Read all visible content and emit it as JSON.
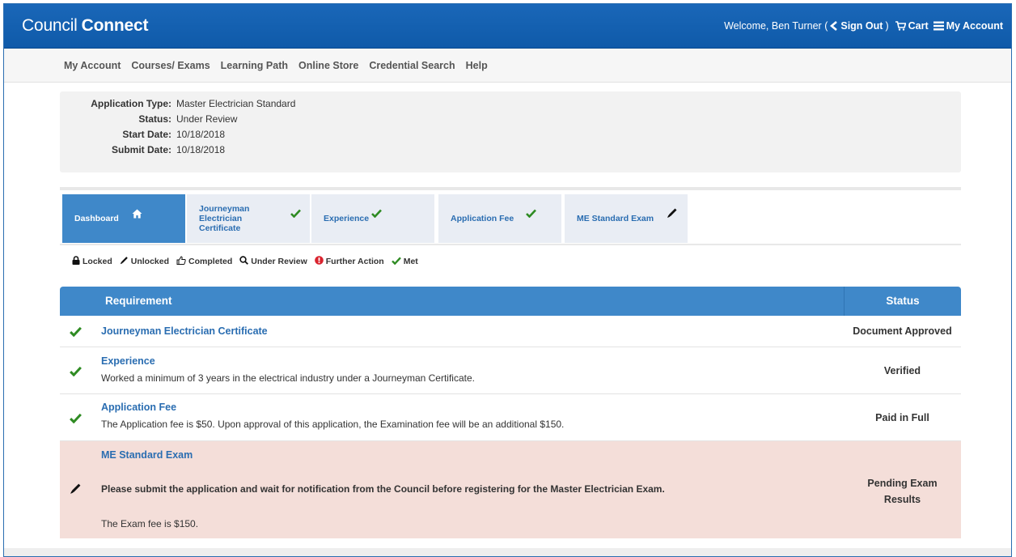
{
  "header": {
    "brand_light": "Council",
    "brand_bold": "Connect",
    "welcome": "Welcome, Ben Turner (",
    "sign_out": "Sign Out",
    "close_paren": ")",
    "cart": "Cart",
    "my_account": "My Account"
  },
  "nav": {
    "items": [
      "My Account",
      "Courses/ Exams",
      "Learning Path",
      "Online Store",
      "Credential Search",
      "Help"
    ]
  },
  "application": {
    "type_label": "Application Type:",
    "type_value": "Master Electrician Standard",
    "status_label": "Status:",
    "status_value": "Under Review",
    "start_label": "Start Date:",
    "start_value": "10/18/2018",
    "submit_label": "Submit Date:",
    "submit_value": "10/18/2018"
  },
  "tabs": [
    {
      "label": "Dashboard",
      "icon": "home-icon"
    },
    {
      "label": "Journeyman Electrician Certificate",
      "line1": "Journeyman",
      "line2": "Electrician",
      "line3": "Certificate",
      "icon": "check-icon"
    },
    {
      "label": "Experience",
      "icon": "check-icon"
    },
    {
      "label": "Application Fee",
      "icon": "check-icon"
    },
    {
      "label": "ME Standard Exam",
      "icon": "pencil-icon"
    }
  ],
  "legend": {
    "locked": "Locked",
    "unlocked": "Unlocked",
    "completed": "Completed",
    "under_review": "Under Review",
    "further_action": "Further Action",
    "met": "Met"
  },
  "table": {
    "col_requirement": "Requirement",
    "col_status": "Status",
    "rows": [
      {
        "icon": "check-icon",
        "title": "Journeyman Electrician Certificate",
        "desc": "",
        "status": "Document Approved"
      },
      {
        "icon": "check-icon",
        "title": "Experience",
        "desc": "Worked a minimum of 3 years in the electrical industry under a Journeyman Certificate.",
        "status": "Verified"
      },
      {
        "icon": "check-icon",
        "title": "Application Fee",
        "desc": "The Application fee is $50. Upon approval of this application, the Examination fee will be an additional $150.",
        "status": "Paid in Full"
      },
      {
        "icon": "pencil-icon",
        "title": "ME Standard Exam",
        "desc": "Please submit the application and wait for notification from the Council before registering for the Master Electrician Exam.",
        "desc2": "The Exam fee is $150.",
        "status_line1": "Pending Exam",
        "status_line2": "Results"
      }
    ]
  },
  "colors": {
    "header_blue": "#1566b7",
    "accent_blue": "#3f88c9",
    "link_blue": "#2a6db1",
    "met_green": "#2e8b22",
    "pending_row": "#f4ded9",
    "alert_red": "#d9232e"
  }
}
